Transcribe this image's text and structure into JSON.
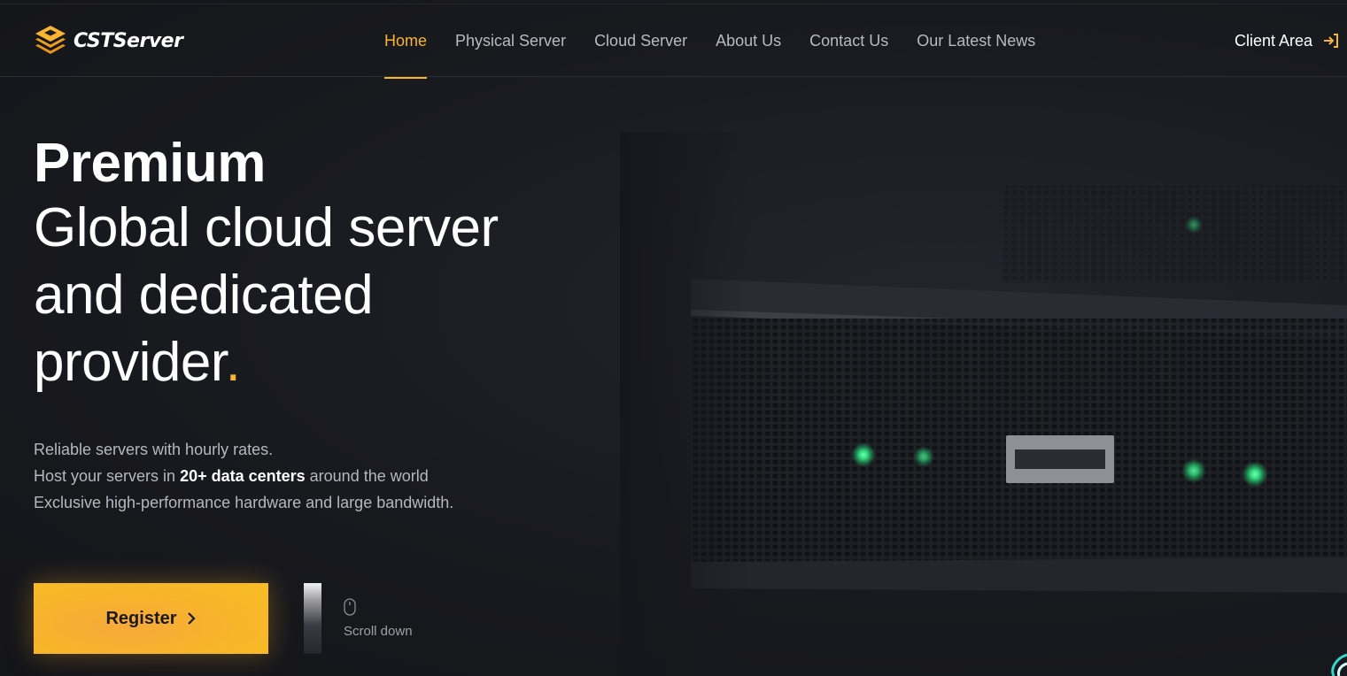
{
  "brand": {
    "name": "CSTServer",
    "accent_color": "#f7b531",
    "logo_icon": "layered-diamond-logo-icon"
  },
  "nav": {
    "items": [
      {
        "label": "Home",
        "active": true
      },
      {
        "label": "Physical Server",
        "active": false
      },
      {
        "label": "Cloud Server",
        "active": false
      },
      {
        "label": "About Us",
        "active": false
      },
      {
        "label": "Contact Us",
        "active": false
      },
      {
        "label": "Our Latest News",
        "active": false
      }
    ],
    "client_area": {
      "label": "Client Area",
      "icon": "login-arrow-icon"
    }
  },
  "hero": {
    "title_bold": "Premium",
    "title_lines": [
      "Global cloud server",
      "and dedicated",
      "provider"
    ],
    "title_end": ".",
    "description": {
      "line1": "Reliable servers with hourly rates.",
      "line2_prefix": "Host your servers in ",
      "line2_bold": "20+ data centers",
      "line2_suffix": " around the world",
      "line3": "Exclusive high-performance hardware and large bandwidth."
    },
    "register_label": "Register",
    "scroll_label": "Scroll down"
  }
}
